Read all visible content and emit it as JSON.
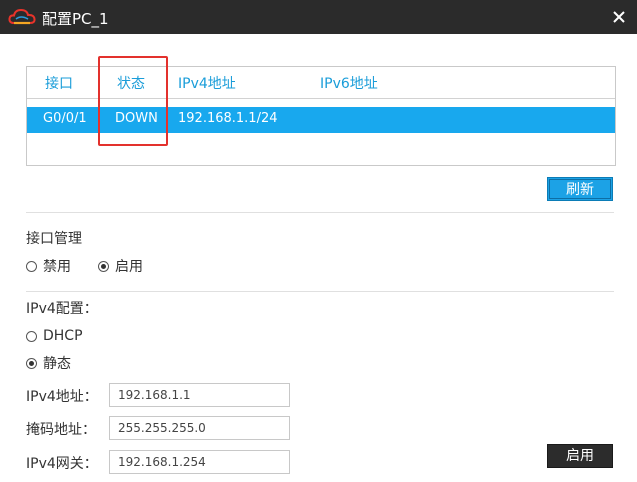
{
  "window": {
    "title": "配置PC_1"
  },
  "table": {
    "headers": [
      "接口",
      "状态",
      "IPv4地址",
      "IPv6地址"
    ],
    "rows": [
      {
        "interface": "G0/0/1",
        "status": "DOWN",
        "ipv4": "192.168.1.1/24",
        "ipv6": ""
      }
    ]
  },
  "refresh_label": "刷新",
  "interface_management": {
    "label": "接口管理",
    "options": [
      "禁用",
      "启用"
    ],
    "selected": "启用"
  },
  "ipv4_config": {
    "label": "IPv4配置：",
    "options": [
      "DHCP",
      "静态"
    ],
    "selected": "静态"
  },
  "fields": {
    "ipv4_label": "IPv4地址：",
    "ipv4_value": "192.168.1.1",
    "mask_label": "掩码地址：",
    "mask_value": "255.255.255.0",
    "gateway_label": "IPv4网关：",
    "gateway_value": "192.168.1.254"
  },
  "enable_label": "启用",
  "colors": {
    "accent": "#1ca2e6",
    "selected_row": "#18a8ee",
    "header_text": "#1a9dd9",
    "highlight": "#e3312d",
    "titlebar": "#2b2b2b"
  }
}
